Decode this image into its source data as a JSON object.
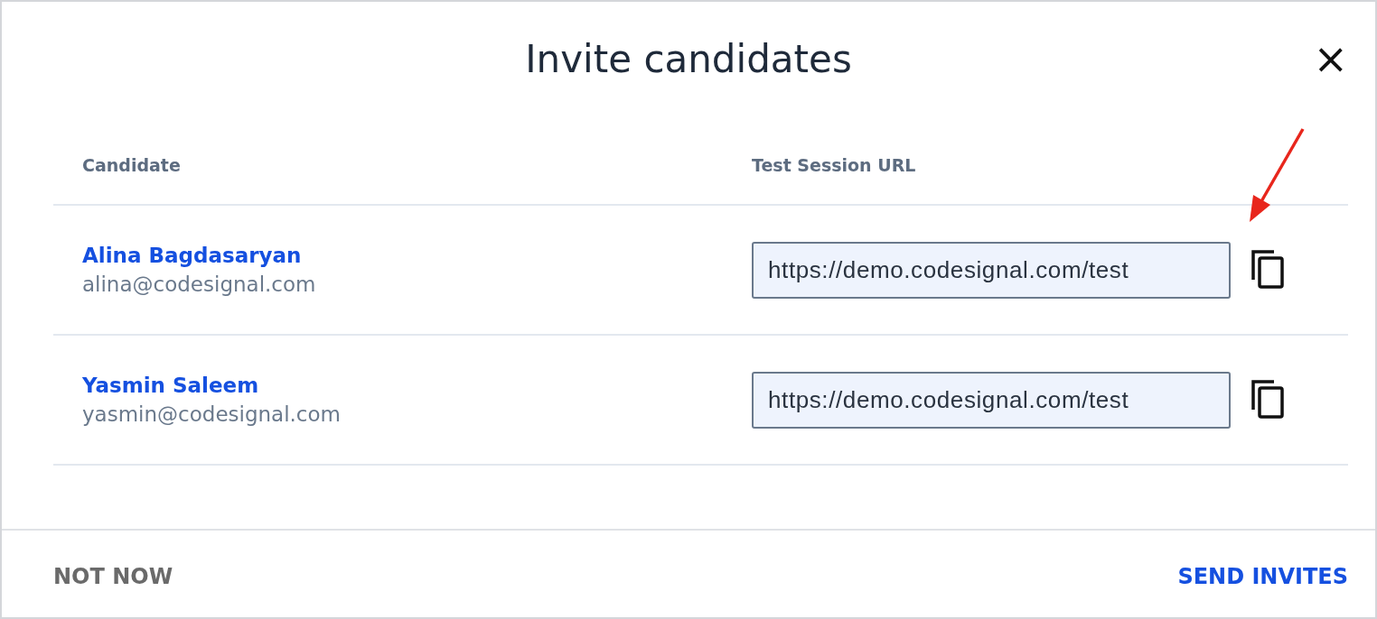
{
  "dialog": {
    "title": "Invite candidates",
    "close": "×"
  },
  "table": {
    "columns": [
      "Candidate",
      "Test Session URL"
    ],
    "rows": [
      {
        "name": "Alina Bagdasaryan",
        "email": "alina@codesignal.com",
        "url": "https://demo.codesignal.com/test",
        "pointed": true
      },
      {
        "name": "Yasmin Saleem",
        "email": "yasmin@codesignal.com",
        "url": "https://demo.codesignal.com/test",
        "pointed": false
      }
    ]
  },
  "footer": {
    "secondary": "NOT NOW",
    "primary": "SEND INVITES"
  }
}
